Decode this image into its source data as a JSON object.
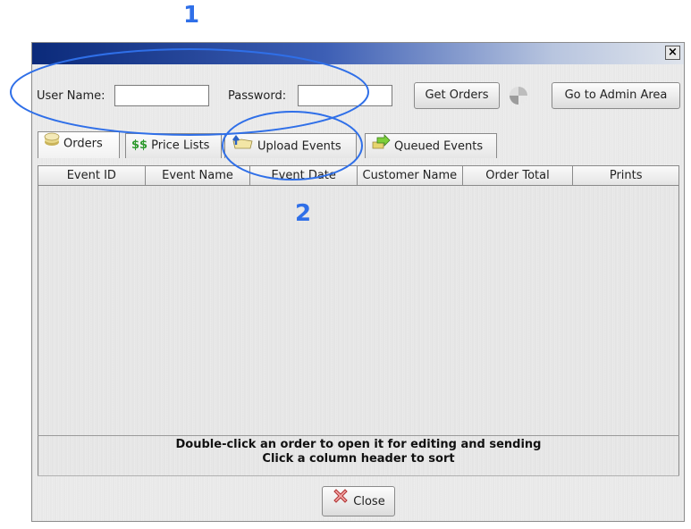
{
  "annotations": {
    "one": "1",
    "two": "2"
  },
  "login": {
    "username_label": "User Name:",
    "username_value": "",
    "password_label": "Password:",
    "password_value": "",
    "get_orders_label": "Get Orders",
    "admin_label": "Go to Admin Area"
  },
  "window": {
    "close_glyph": "×"
  },
  "tabs": [
    {
      "label": "Orders",
      "icon": "orders-stack-icon"
    },
    {
      "label": "Price Lists",
      "icon": "dollar-icon"
    },
    {
      "label": "Upload Events",
      "icon": "upload-folder-icon"
    },
    {
      "label": "Queued Events",
      "icon": "queued-arrow-icon"
    }
  ],
  "table": {
    "columns": [
      "Event ID",
      "Event Name",
      "Event Date",
      "Customer Name",
      "Order Total",
      "Prints"
    ],
    "rows": []
  },
  "hint": {
    "line1": "Double-click an order to open it for editing and sending",
    "line2": "Click a column header to sort"
  },
  "footer": {
    "close_label": "Close"
  },
  "colors": {
    "annotation": "#2f6fe8",
    "titlebar_start": "#0b2a7a"
  }
}
